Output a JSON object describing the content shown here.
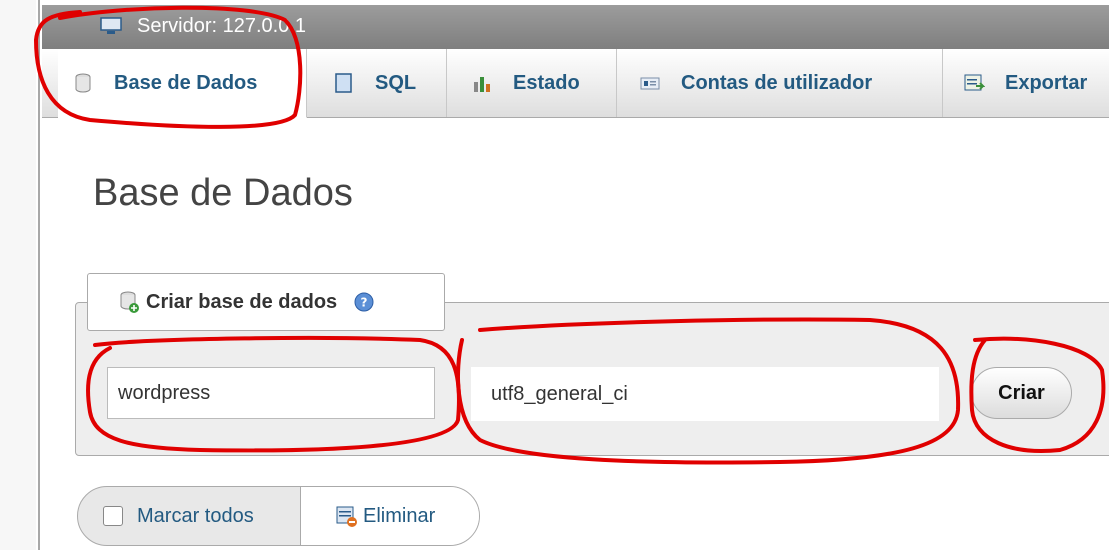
{
  "server_bar": {
    "text": "Servidor: 127.0.0.1"
  },
  "tabs": [
    {
      "label": "Base de Dados",
      "icon": "database-icon"
    },
    {
      "label": "SQL",
      "icon": "sql-icon"
    },
    {
      "label": "Estado",
      "icon": "status-icon"
    },
    {
      "label": "Contas de utilizador",
      "icon": "user-accounts-icon"
    },
    {
      "label": "Exportar",
      "icon": "export-icon"
    }
  ],
  "page_title": "Base de Dados",
  "create_db": {
    "legend": "Criar base de dados",
    "name_value": "wordpress",
    "collation_value": "utf8_general_ci",
    "button_label": "Criar"
  },
  "bulk": {
    "check_all_label": "Marcar todos",
    "delete_label": "Eliminar"
  },
  "colors": {
    "link": "#235a81",
    "annotation_red": "#e00000"
  }
}
